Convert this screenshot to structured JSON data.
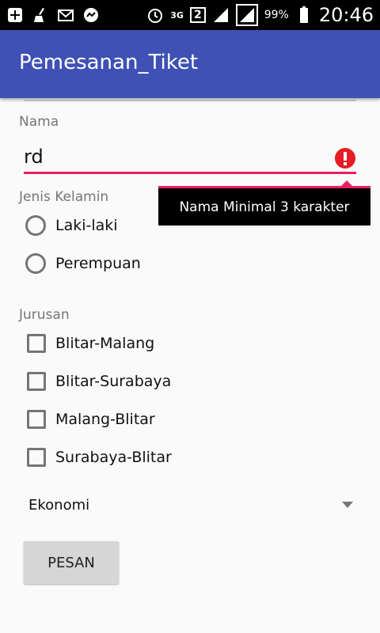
{
  "status_bar": {
    "icons": [
      "plus-box-icon",
      "broom-icon",
      "mail-icon",
      "messenger-icon",
      "alarm-icon",
      "network-3g-icon",
      "sim2-icon",
      "signal-icon",
      "signal-icon",
      "battery-icon"
    ],
    "network": "3G",
    "sim_badge": "2",
    "battery": "99%",
    "time": "20:46"
  },
  "app_bar": {
    "title": "Pemesanan_Tiket"
  },
  "form": {
    "name_label": "Nama",
    "name_value": "rd",
    "name_error": "Nama Minimal 3 karakter",
    "gender_label": "Jenis Kelamin",
    "gender_options": [
      "Laki-laki",
      "Perempuan"
    ],
    "route_label": "Jurusan",
    "route_options": [
      "Blitar-Malang",
      "Blitar-Surabaya",
      "Malang-Blitar",
      "Surabaya-Blitar"
    ],
    "class_selected": "Ekonomi",
    "submit_label": "PESAN"
  },
  "colors": {
    "primary": "#3f51b5",
    "error": "#e91e63",
    "error_icon": "#e51c23"
  }
}
